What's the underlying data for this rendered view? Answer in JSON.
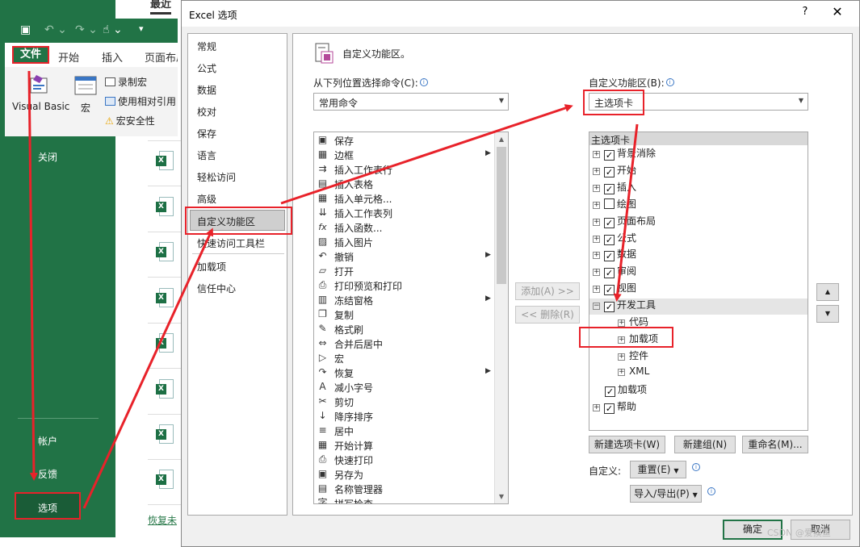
{
  "colors": {
    "excel_green": "#217346",
    "annotation_red": "#e8222a",
    "selection_gray": "#cfcfcf"
  },
  "backstage": {
    "recent_tab": "最近",
    "close": "关闭",
    "account": "帐户",
    "feedback": "反馈",
    "options": "选项",
    "recover": "恢复未"
  },
  "ribbon": {
    "tabs": {
      "file": "文件",
      "home": "开始",
      "insert": "插入",
      "page_layout": "页面布局"
    },
    "visual_basic": "Visual Basic",
    "macro": "宏",
    "record_macro": "录制宏",
    "use_relative": "使用相对引用",
    "macro_security": "宏安全性"
  },
  "dialog": {
    "title": "Excel 选项",
    "help": "?",
    "close": "✕",
    "nav": [
      "常规",
      "公式",
      "数据",
      "校对",
      "保存",
      "语言",
      "轻松访问",
      "高级",
      "自定义功能区",
      "快速访问工具栏",
      "加载项",
      "信任中心"
    ],
    "section_title": "自定义功能区。",
    "choose_from_label": "从下列位置选择命令(C):",
    "choose_from_value": "常用命令",
    "customize_label": "自定义功能区(B):",
    "customize_value": "主选项卡",
    "commands": [
      {
        "icon": "save-icon",
        "glyph": "▣",
        "label": "保存",
        "sub": false
      },
      {
        "icon": "borders-icon",
        "glyph": "▦",
        "label": "边框",
        "sub": true
      },
      {
        "icon": "insert-rows-icon",
        "glyph": "⇉",
        "label": "插入工作表行",
        "sub": false
      },
      {
        "icon": "table-icon",
        "glyph": "▤",
        "label": "插入表格",
        "sub": false
      },
      {
        "icon": "insert-cells-icon",
        "glyph": "▦",
        "label": "插入单元格...",
        "sub": false
      },
      {
        "icon": "insert-columns-icon",
        "glyph": "⇊",
        "label": "插入工作表列",
        "sub": false
      },
      {
        "icon": "function-icon",
        "glyph": "fx",
        "label": "插入函数...",
        "sub": false
      },
      {
        "icon": "picture-icon",
        "glyph": "▨",
        "label": "插入图片",
        "sub": false
      },
      {
        "icon": "undo-icon",
        "glyph": "↶",
        "label": "撤销",
        "sub": true
      },
      {
        "icon": "open-icon",
        "glyph": "▱",
        "label": "打开",
        "sub": false
      },
      {
        "icon": "print-preview-icon",
        "glyph": "⎙",
        "label": "打印预览和打印",
        "sub": false
      },
      {
        "icon": "freeze-panes-icon",
        "glyph": "▥",
        "label": "冻结窗格",
        "sub": true
      },
      {
        "icon": "copy-icon",
        "glyph": "❐",
        "label": "复制",
        "sub": false
      },
      {
        "icon": "format-painter-icon",
        "glyph": "✎",
        "label": "格式刷",
        "sub": false
      },
      {
        "icon": "merge-center-icon",
        "glyph": "⇔",
        "label": "合并后居中",
        "sub": false
      },
      {
        "icon": "macro-icon",
        "glyph": "▷",
        "label": "宏",
        "sub": false
      },
      {
        "icon": "redo-icon",
        "glyph": "↷",
        "label": "恢复",
        "sub": true
      },
      {
        "icon": "decrease-font-icon",
        "glyph": "A",
        "label": "减小字号",
        "sub": false
      },
      {
        "icon": "cut-icon",
        "glyph": "✂",
        "label": "剪切",
        "sub": false
      },
      {
        "icon": "sort-descending-icon",
        "glyph": "↓",
        "label": "降序排序",
        "sub": false
      },
      {
        "icon": "center-icon",
        "glyph": "≡",
        "label": "居中",
        "sub": false
      },
      {
        "icon": "calculate-icon",
        "glyph": "▦",
        "label": "开始计算",
        "sub": false
      },
      {
        "icon": "quick-print-icon",
        "glyph": "⎙",
        "label": "快速打印",
        "sub": false
      },
      {
        "icon": "save-as-icon",
        "glyph": "▣",
        "label": "另存为",
        "sub": false
      },
      {
        "icon": "name-manager-icon",
        "glyph": "▤",
        "label": "名称管理器",
        "sub": false
      },
      {
        "icon": "spelling-icon",
        "glyph": "字",
        "label": "拼写检查",
        "sub": false
      }
    ],
    "add_btn": "添加(A) >>",
    "remove_btn": "<< 删除(R)",
    "tree_header": "主选项卡",
    "tree": [
      {
        "label": "背景消除",
        "checked": true,
        "exp": true,
        "indent": 0
      },
      {
        "label": "开始",
        "checked": true,
        "exp": true,
        "indent": 0
      },
      {
        "label": "插入",
        "checked": true,
        "exp": true,
        "indent": 0
      },
      {
        "label": "绘图",
        "checked": false,
        "exp": true,
        "indent": 0
      },
      {
        "label": "页面布局",
        "checked": true,
        "exp": true,
        "indent": 0
      },
      {
        "label": "公式",
        "checked": true,
        "exp": true,
        "indent": 0
      },
      {
        "label": "数据",
        "checked": true,
        "exp": true,
        "indent": 0
      },
      {
        "label": "审阅",
        "checked": true,
        "exp": true,
        "indent": 0
      },
      {
        "label": "视图",
        "checked": true,
        "exp": true,
        "indent": 0
      },
      {
        "label": "开发工具",
        "checked": true,
        "exp": true,
        "indent": 0,
        "open": true
      },
      {
        "label": "代码",
        "checked": null,
        "exp": true,
        "indent": 1
      },
      {
        "label": "加载项",
        "checked": null,
        "exp": true,
        "indent": 1
      },
      {
        "label": "控件",
        "checked": null,
        "exp": true,
        "indent": 1
      },
      {
        "label": "XML",
        "checked": null,
        "exp": true,
        "indent": 1
      },
      {
        "label": "加载项",
        "checked": true,
        "exp": false,
        "indent": 0
      },
      {
        "label": "帮助",
        "checked": true,
        "exp": true,
        "indent": 0
      }
    ],
    "new_tab_btn": "新建选项卡(W)",
    "new_group_btn": "新建组(N)",
    "rename_btn": "重命名(M)...",
    "customize_lbl": "自定义:",
    "reset_btn": "重置(E)",
    "import_export_btn": "导入/导出(P)",
    "ok": "确定",
    "cancel": "取消"
  },
  "watermark": "CSDN @爱摸鱼"
}
